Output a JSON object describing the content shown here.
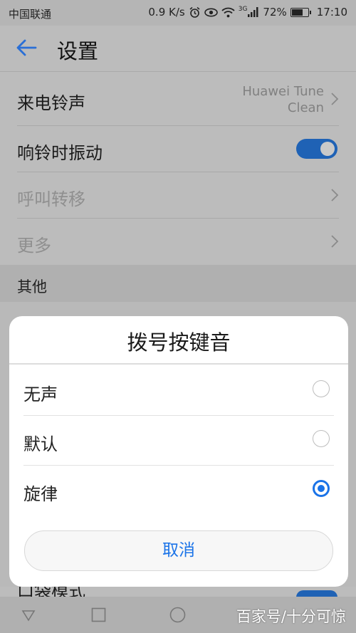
{
  "status_bar": {
    "carrier": "中国联通",
    "net_speed": "0.9 K/s",
    "network_type": "3G",
    "battery": "72%",
    "time": "17:10"
  },
  "app_bar": {
    "title": "设置",
    "back_icon": "arrow-left-icon"
  },
  "settings": {
    "ringtone": {
      "label": "来电铃声",
      "value_line1": "Huawei Tune",
      "value_line2": "Clean"
    },
    "vibrate": {
      "label": "响铃时振动",
      "on": true
    },
    "call_forward": {
      "label": "呼叫转移"
    },
    "more": {
      "label": "更多"
    },
    "section_other": "其他",
    "pocket_mode": {
      "label": "口袋模式",
      "on": true
    }
  },
  "dialog": {
    "title": "拨号按键音",
    "options": [
      {
        "label": "无声",
        "selected": false
      },
      {
        "label": "默认",
        "selected": false
      },
      {
        "label": "旋律",
        "selected": true
      }
    ],
    "cancel_label": "取消"
  },
  "watermark": "百家号/十分可惊",
  "colors": {
    "accent": "#1a73e8",
    "toggle_on": "#1f62b5",
    "scrim": "#bcbcbc"
  }
}
